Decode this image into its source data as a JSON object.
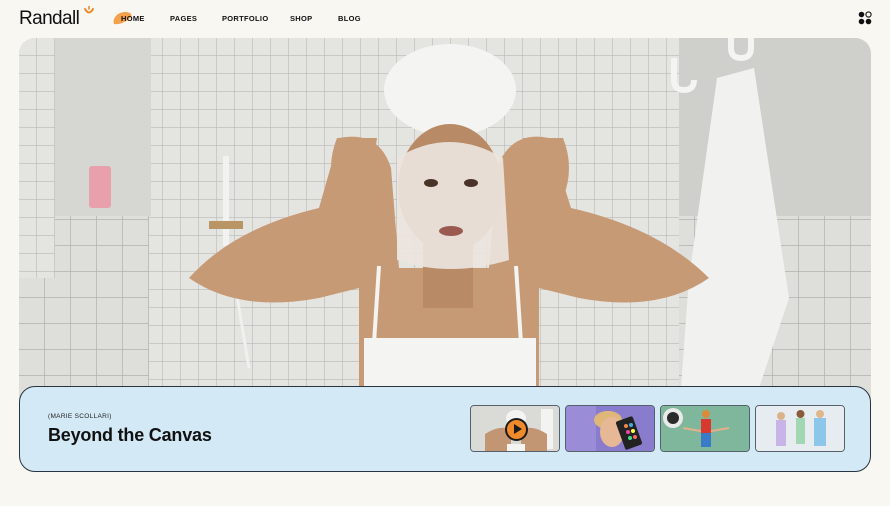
{
  "header": {
    "logo_text": "Randall",
    "nav": [
      {
        "label": "HOME"
      },
      {
        "label": "PAGES"
      },
      {
        "label": "PORTFOLIO"
      },
      {
        "label": "SHOP"
      },
      {
        "label": "BLOG"
      }
    ],
    "accent_color": "#f08a2a"
  },
  "hero": {
    "author": "(MARIE SCOLLARI)",
    "title": "Beyond the Canvas",
    "card_color": "#d4e9f6",
    "thumbnails": [
      {
        "name": "face-mask-video",
        "has_play": true
      },
      {
        "name": "palette-portrait"
      },
      {
        "name": "green-dancer"
      },
      {
        "name": "group-outfits"
      }
    ]
  }
}
